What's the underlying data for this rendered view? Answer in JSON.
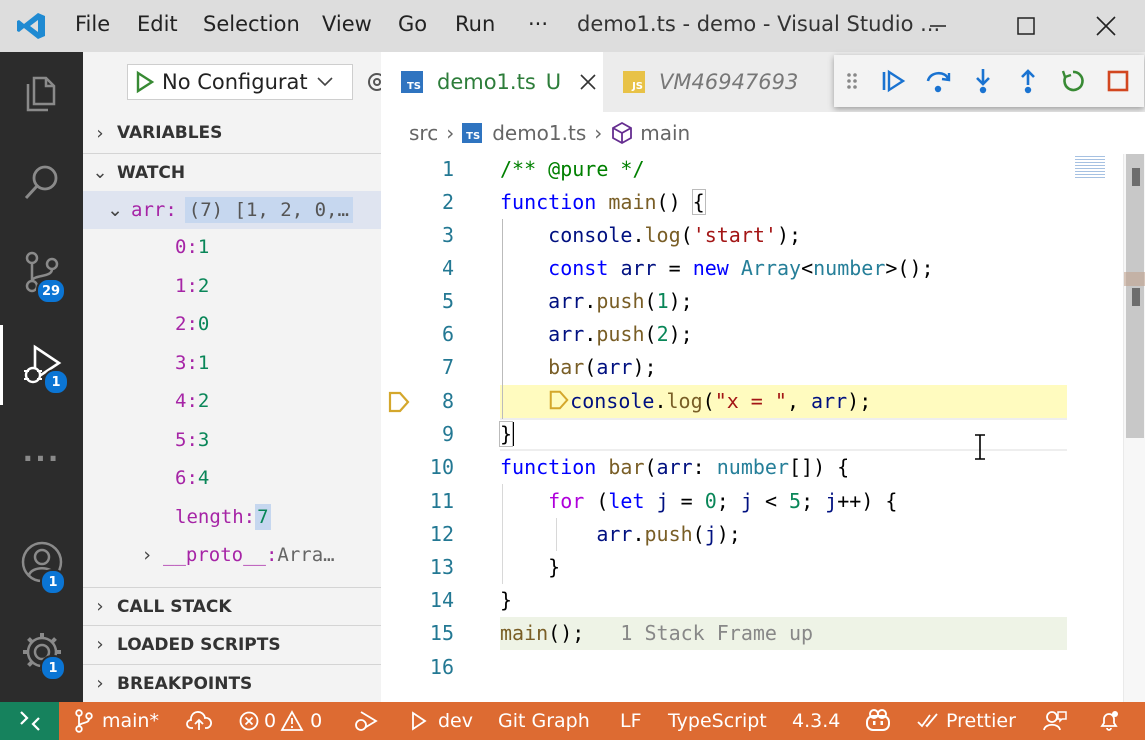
{
  "titlebar": {
    "menu": [
      "File",
      "Edit",
      "Selection",
      "View",
      "Go",
      "Run"
    ],
    "more": "···",
    "title": "demo1.ts - demo - Visual Studio ..."
  },
  "activity": {
    "scm_badge": "29",
    "debug_badge": "1",
    "accounts_badge": "1",
    "manage_badge": "1",
    "more": "···"
  },
  "sidebar": {
    "config_select": "No Configurat",
    "sections": {
      "variables": "VARIABLES",
      "watch": "WATCH",
      "call_stack": "CALL STACK",
      "loaded_scripts": "LOADED SCRIPTS",
      "breakpoints": "BREAKPOINTS"
    },
    "watch": {
      "expr_name": "arr",
      "expr_value": "(7) [1, 2, 0,…",
      "children": [
        {
          "key": "0",
          "value": "1"
        },
        {
          "key": "1",
          "value": "2"
        },
        {
          "key": "2",
          "value": "0"
        },
        {
          "key": "3",
          "value": "1"
        },
        {
          "key": "4",
          "value": "2"
        },
        {
          "key": "5",
          "value": "3"
        },
        {
          "key": "6",
          "value": "4"
        },
        {
          "key": "length",
          "value": "7"
        }
      ],
      "proto_key": "__proto__",
      "proto_value": "Arra…"
    }
  },
  "tabs": [
    {
      "icon": "TS",
      "name": "demo1.ts",
      "status": "U"
    },
    {
      "icon": "JS",
      "name": "VM46947693"
    }
  ],
  "breadcrumb": {
    "folder": "src",
    "file": "demo1.ts",
    "symbol": "main"
  },
  "editor": {
    "lines": [
      "1",
      "2",
      "3",
      "4",
      "5",
      "6",
      "7",
      "8",
      "9",
      "10",
      "11",
      "12",
      "13",
      "14",
      "15",
      "16"
    ],
    "line15_hint": "1 Stack Frame up"
  },
  "statusbar": {
    "branch": "main*",
    "errors": "0",
    "warnings": "0",
    "debug_target": "dev",
    "git_graph": "Git Graph",
    "eol": "LF",
    "language": "TypeScript",
    "ts_version": "4.3.4",
    "prettier": "Prettier"
  },
  "colors": {
    "statusbar_bg": "#dd6b32",
    "remote_bg": "#16825d",
    "activity_bg": "#2c2c2c",
    "badge": "#0b75d4",
    "current_line": "#fffbbf",
    "debug_icon_blue": "#1a73d1",
    "debug_restart": "#388a34",
    "debug_stop": "#d2461f"
  }
}
